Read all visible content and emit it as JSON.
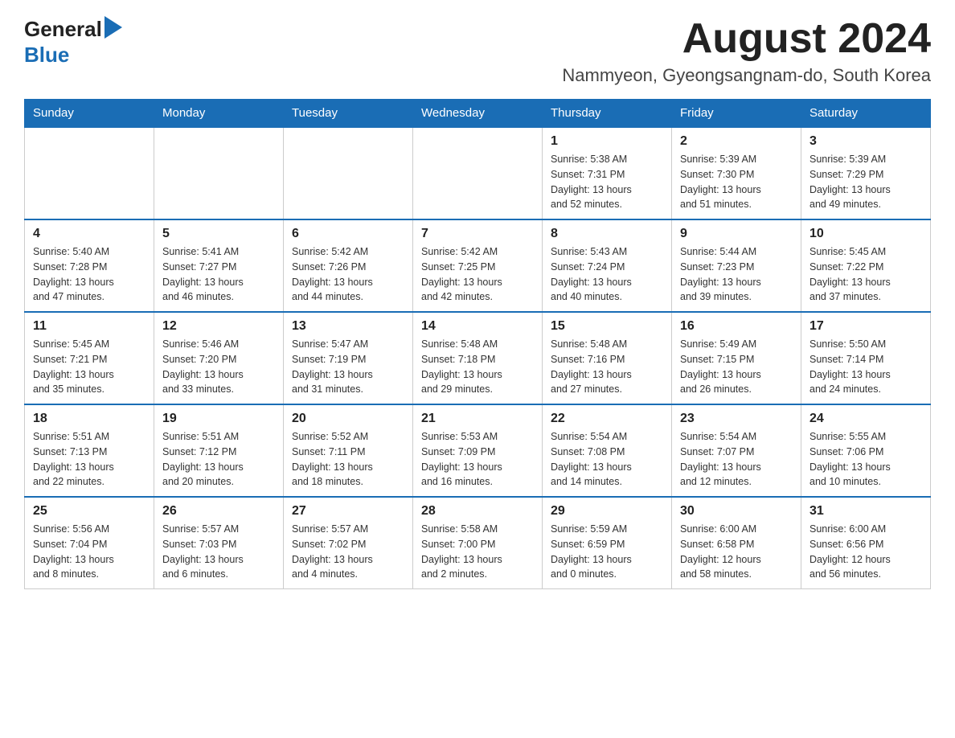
{
  "header": {
    "logo_general": "General",
    "logo_blue": "Blue",
    "month": "August 2024",
    "location": "Nammyeon, Gyeongsangnam-do, South Korea"
  },
  "weekdays": [
    "Sunday",
    "Monday",
    "Tuesday",
    "Wednesday",
    "Thursday",
    "Friday",
    "Saturday"
  ],
  "weeks": [
    [
      {
        "day": "",
        "info": ""
      },
      {
        "day": "",
        "info": ""
      },
      {
        "day": "",
        "info": ""
      },
      {
        "day": "",
        "info": ""
      },
      {
        "day": "1",
        "info": "Sunrise: 5:38 AM\nSunset: 7:31 PM\nDaylight: 13 hours\nand 52 minutes."
      },
      {
        "day": "2",
        "info": "Sunrise: 5:39 AM\nSunset: 7:30 PM\nDaylight: 13 hours\nand 51 minutes."
      },
      {
        "day": "3",
        "info": "Sunrise: 5:39 AM\nSunset: 7:29 PM\nDaylight: 13 hours\nand 49 minutes."
      }
    ],
    [
      {
        "day": "4",
        "info": "Sunrise: 5:40 AM\nSunset: 7:28 PM\nDaylight: 13 hours\nand 47 minutes."
      },
      {
        "day": "5",
        "info": "Sunrise: 5:41 AM\nSunset: 7:27 PM\nDaylight: 13 hours\nand 46 minutes."
      },
      {
        "day": "6",
        "info": "Sunrise: 5:42 AM\nSunset: 7:26 PM\nDaylight: 13 hours\nand 44 minutes."
      },
      {
        "day": "7",
        "info": "Sunrise: 5:42 AM\nSunset: 7:25 PM\nDaylight: 13 hours\nand 42 minutes."
      },
      {
        "day": "8",
        "info": "Sunrise: 5:43 AM\nSunset: 7:24 PM\nDaylight: 13 hours\nand 40 minutes."
      },
      {
        "day": "9",
        "info": "Sunrise: 5:44 AM\nSunset: 7:23 PM\nDaylight: 13 hours\nand 39 minutes."
      },
      {
        "day": "10",
        "info": "Sunrise: 5:45 AM\nSunset: 7:22 PM\nDaylight: 13 hours\nand 37 minutes."
      }
    ],
    [
      {
        "day": "11",
        "info": "Sunrise: 5:45 AM\nSunset: 7:21 PM\nDaylight: 13 hours\nand 35 minutes."
      },
      {
        "day": "12",
        "info": "Sunrise: 5:46 AM\nSunset: 7:20 PM\nDaylight: 13 hours\nand 33 minutes."
      },
      {
        "day": "13",
        "info": "Sunrise: 5:47 AM\nSunset: 7:19 PM\nDaylight: 13 hours\nand 31 minutes."
      },
      {
        "day": "14",
        "info": "Sunrise: 5:48 AM\nSunset: 7:18 PM\nDaylight: 13 hours\nand 29 minutes."
      },
      {
        "day": "15",
        "info": "Sunrise: 5:48 AM\nSunset: 7:16 PM\nDaylight: 13 hours\nand 27 minutes."
      },
      {
        "day": "16",
        "info": "Sunrise: 5:49 AM\nSunset: 7:15 PM\nDaylight: 13 hours\nand 26 minutes."
      },
      {
        "day": "17",
        "info": "Sunrise: 5:50 AM\nSunset: 7:14 PM\nDaylight: 13 hours\nand 24 minutes."
      }
    ],
    [
      {
        "day": "18",
        "info": "Sunrise: 5:51 AM\nSunset: 7:13 PM\nDaylight: 13 hours\nand 22 minutes."
      },
      {
        "day": "19",
        "info": "Sunrise: 5:51 AM\nSunset: 7:12 PM\nDaylight: 13 hours\nand 20 minutes."
      },
      {
        "day": "20",
        "info": "Sunrise: 5:52 AM\nSunset: 7:11 PM\nDaylight: 13 hours\nand 18 minutes."
      },
      {
        "day": "21",
        "info": "Sunrise: 5:53 AM\nSunset: 7:09 PM\nDaylight: 13 hours\nand 16 minutes."
      },
      {
        "day": "22",
        "info": "Sunrise: 5:54 AM\nSunset: 7:08 PM\nDaylight: 13 hours\nand 14 minutes."
      },
      {
        "day": "23",
        "info": "Sunrise: 5:54 AM\nSunset: 7:07 PM\nDaylight: 13 hours\nand 12 minutes."
      },
      {
        "day": "24",
        "info": "Sunrise: 5:55 AM\nSunset: 7:06 PM\nDaylight: 13 hours\nand 10 minutes."
      }
    ],
    [
      {
        "day": "25",
        "info": "Sunrise: 5:56 AM\nSunset: 7:04 PM\nDaylight: 13 hours\nand 8 minutes."
      },
      {
        "day": "26",
        "info": "Sunrise: 5:57 AM\nSunset: 7:03 PM\nDaylight: 13 hours\nand 6 minutes."
      },
      {
        "day": "27",
        "info": "Sunrise: 5:57 AM\nSunset: 7:02 PM\nDaylight: 13 hours\nand 4 minutes."
      },
      {
        "day": "28",
        "info": "Sunrise: 5:58 AM\nSunset: 7:00 PM\nDaylight: 13 hours\nand 2 minutes."
      },
      {
        "day": "29",
        "info": "Sunrise: 5:59 AM\nSunset: 6:59 PM\nDaylight: 13 hours\nand 0 minutes."
      },
      {
        "day": "30",
        "info": "Sunrise: 6:00 AM\nSunset: 6:58 PM\nDaylight: 12 hours\nand 58 minutes."
      },
      {
        "day": "31",
        "info": "Sunrise: 6:00 AM\nSunset: 6:56 PM\nDaylight: 12 hours\nand 56 minutes."
      }
    ]
  ]
}
